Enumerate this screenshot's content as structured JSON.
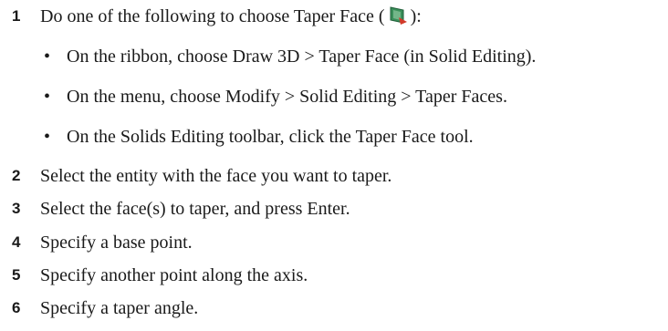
{
  "steps": {
    "s1": {
      "number": "1",
      "text_before": "Do one of the following to choose Taper Face (",
      "text_after": "):",
      "icon": "taper-face-icon"
    },
    "bullets": [
      "On the ribbon, choose Draw 3D > Taper Face (in Solid Editing).",
      "On the menu, choose Modify > Solid Editing > Taper Faces.",
      "On the Solids Editing toolbar, click the Taper Face tool."
    ],
    "bullet_symbol": "•",
    "s2": {
      "number": "2",
      "text": "Select the entity with the face you want to taper."
    },
    "s3": {
      "number": "3",
      "text": "Select the face(s) to taper, and press Enter."
    },
    "s4": {
      "number": "4",
      "text": "Specify a base point."
    },
    "s5": {
      "number": "5",
      "text": "Specify another point along the axis."
    },
    "s6": {
      "number": "6",
      "text": "Specify a taper angle."
    }
  },
  "colors": {
    "text": "#1a1a1a",
    "icon_green": "#3a8f5a",
    "icon_arrow": "#d23a2a"
  }
}
